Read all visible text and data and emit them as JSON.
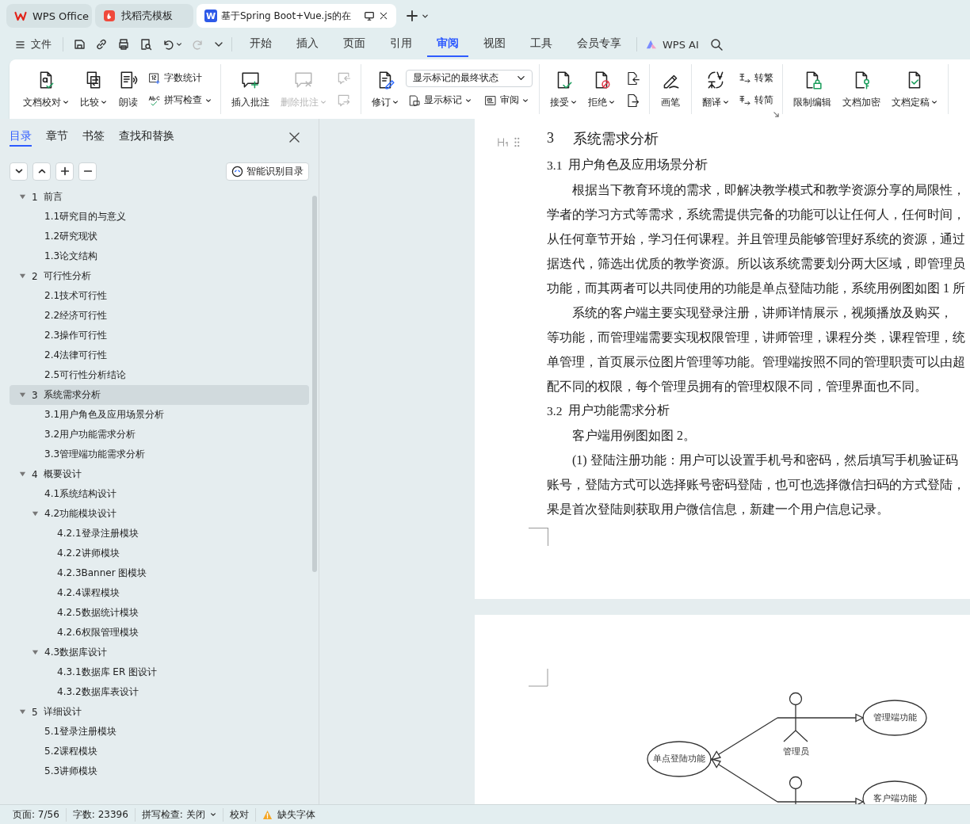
{
  "browser_tabs": [
    {
      "label": "WPS Office",
      "selected": false
    },
    {
      "label": "找稻壳模板",
      "selected": false
    },
    {
      "label": "基于Spring Boot+Vue.js的在",
      "selected": true,
      "badge": "W"
    }
  ],
  "file_menu": {
    "label": "文件"
  },
  "quick_access": [
    {
      "disabled": false,
      "dropdown": false
    },
    {
      "disabled": false,
      "dropdown": false
    },
    {
      "disabled": false,
      "dropdown": false
    },
    {
      "disabled": false,
      "dropdown": false
    },
    {
      "disabled": false,
      "dropdown": true
    },
    {
      "disabled": true,
      "dropdown": false
    }
  ],
  "menu_tabs": [
    {
      "label": "开始",
      "selected": false
    },
    {
      "label": "插入",
      "selected": false
    },
    {
      "label": "页面",
      "selected": false
    },
    {
      "label": "引用",
      "selected": false
    },
    {
      "label": "审阅",
      "selected": true
    },
    {
      "label": "视图",
      "selected": false
    },
    {
      "label": "工具",
      "selected": false
    },
    {
      "label": "会员专享",
      "selected": false
    }
  ],
  "ai_button": {
    "label": "WPS AI"
  },
  "ribbon": {
    "groups": [
      {
        "launcher": false,
        "columns": [
          {
            "kind": "big",
            "label": "文档校对",
            "dropdown": true,
            "disabled": false
          },
          {
            "kind": "big",
            "label": "比较",
            "dropdown": true,
            "disabled": false
          },
          {
            "kind": "big",
            "label": "朗读",
            "dropdown": false,
            "disabled": false
          },
          {
            "kind": "stack",
            "items": [
              {
                "kind": "small",
                "label": "字数统计",
                "dropdown": false,
                "disabled": false
              },
              {
                "kind": "small",
                "label": "拼写检查",
                "dropdown": true,
                "disabled": false
              }
            ]
          }
        ]
      },
      {
        "launcher": false,
        "columns": [
          {
            "kind": "big",
            "label": "插入批注",
            "dropdown": false,
            "disabled": false
          },
          {
            "kind": "big",
            "label": "删除批注",
            "dropdown": true,
            "disabled": true
          },
          {
            "kind": "stack",
            "items": [
              {
                "kind": "icon",
                "disabled": true
              },
              {
                "kind": "icon",
                "disabled": true
              }
            ]
          }
        ]
      },
      {
        "launcher": false,
        "columns": [
          {
            "kind": "big",
            "label": "修订",
            "dropdown": true,
            "disabled": false
          },
          {
            "kind": "stack",
            "items": [
              {
                "kind": "select",
                "value": "显示标记的最终状态"
              },
              {
                "kind": "pair",
                "items": [
                  {
                    "kind": "small",
                    "label": "显示标记",
                    "dropdown": true,
                    "disabled": false
                  },
                  {
                    "kind": "small",
                    "label": "审阅",
                    "dropdown": true,
                    "disabled": false
                  }
                ]
              }
            ]
          }
        ]
      },
      {
        "launcher": false,
        "columns": [
          {
            "kind": "big",
            "label": "接受",
            "dropdown": true,
            "disabled": false
          },
          {
            "kind": "big",
            "label": "拒绝",
            "dropdown": true,
            "disabled": false
          },
          {
            "kind": "stack",
            "items": [
              {
                "kind": "icon",
                "disabled": false
              },
              {
                "kind": "icon",
                "disabled": false
              }
            ]
          }
        ]
      },
      {
        "launcher": false,
        "columns": [
          {
            "kind": "big",
            "label": "画笔",
            "dropdown": false,
            "disabled": false
          }
        ]
      },
      {
        "launcher": true,
        "columns": [
          {
            "kind": "big",
            "label": "翻译",
            "dropdown": true,
            "disabled": false
          },
          {
            "kind": "stack",
            "items": [
              {
                "kind": "small",
                "label": "转繁",
                "dropdown": false,
                "disabled": false
              },
              {
                "kind": "small",
                "label": "转简",
                "dropdown": false,
                "disabled": false
              }
            ]
          }
        ]
      },
      {
        "launcher": false,
        "columns": [
          {
            "kind": "big",
            "label": "限制编辑",
            "dropdown": false,
            "disabled": false
          },
          {
            "kind": "big",
            "label": "文档加密",
            "dropdown": false,
            "disabled": false
          },
          {
            "kind": "big",
            "label": "文档定稿",
            "dropdown": true,
            "disabled": false
          }
        ]
      }
    ]
  },
  "navigation": {
    "tabs": [
      {
        "label": "目录",
        "selected": true
      },
      {
        "label": "章节",
        "selected": false
      },
      {
        "label": "书签",
        "selected": false
      },
      {
        "label": "查找和替换",
        "selected": false
      }
    ],
    "smart_button": {
      "label": "智能识别目录"
    },
    "outline": [
      {
        "number": "1",
        "title": "前言",
        "selected": false,
        "expanded": true,
        "children": [
          {
            "title": "1.1研究目的与意义",
            "selected": false
          },
          {
            "title": "1.2研究现状",
            "selected": false
          },
          {
            "title": "1.3论文结构",
            "selected": false
          }
        ]
      },
      {
        "number": "2",
        "title": "可行性分析",
        "selected": false,
        "expanded": true,
        "children": [
          {
            "title": "2.1技术可行性",
            "selected": false
          },
          {
            "title": "2.2经济可行性",
            "selected": false
          },
          {
            "title": "2.3操作可行性",
            "selected": false
          },
          {
            "title": "2.4法律可行性",
            "selected": false
          },
          {
            "title": "2.5可行性分析结论",
            "selected": false
          }
        ]
      },
      {
        "number": "3",
        "title": "系统需求分析",
        "selected": true,
        "expanded": true,
        "children": [
          {
            "title": "3.1用户角色及应用场景分析",
            "selected": false
          },
          {
            "title": "3.2用户功能需求分析",
            "selected": false
          },
          {
            "title": "3.3管理端功能需求分析",
            "selected": false
          }
        ]
      },
      {
        "number": "4",
        "title": "概要设计",
        "selected": false,
        "expanded": true,
        "children": [
          {
            "title": "4.1系统结构设计",
            "selected": false
          },
          {
            "title": "4.2功能模块设计",
            "selected": false,
            "expanded": true,
            "children": [
              {
                "title": "4.2.1登录注册模块",
                "selected": false
              },
              {
                "title": "4.2.2讲师模块",
                "selected": false
              },
              {
                "title": "4.2.3Banner 图模块",
                "selected": false
              },
              {
                "title": "4.2.4课程模块",
                "selected": false
              },
              {
                "title": "4.2.5数据统计模块",
                "selected": false
              },
              {
                "title": "4.2.6权限管理模块",
                "selected": false
              }
            ]
          },
          {
            "title": "4.3数据库设计",
            "selected": false,
            "expanded": true,
            "children": [
              {
                "title": "4.3.1数据库 ER 图设计",
                "selected": false
              },
              {
                "title": "4.3.2数据库表设计",
                "selected": false
              }
            ]
          }
        ]
      },
      {
        "number": "5",
        "title": "详细设计",
        "selected": false,
        "expanded": true,
        "children": [
          {
            "title": "5.1登录注册模块",
            "selected": false
          },
          {
            "title": "5.2课程模块",
            "selected": false
          },
          {
            "title": "5.3讲师模块",
            "selected": false
          }
        ]
      }
    ]
  },
  "document": {
    "heading": {
      "number": "3",
      "title": "系统需求分析"
    },
    "blocks": [
      {
        "kind": "subheading",
        "number": "3.1",
        "title": "用户角色及应用场景分析"
      },
      {
        "kind": "paragraph",
        "lines": [
          "根据当下教育环境的需求，即解决教学模式和教学资源分享的局限性，",
          "学者的学习方式等需求，系统需提供完备的功能可以让任何人，任何时间，",
          "从任何章节开始，学习任何课程。并且管理员能够管理好系统的资源，通过",
          "据迭代，筛选出优质的教学资源。所以该系统需要划分两大区域，即管理员",
          "功能，而其两者可以共同使用的功能是单点登陆功能，系统用例图如图 1 所"
        ]
      },
      {
        "kind": "paragraph",
        "lines": [
          "系统的客户端主要实现登录注册，讲师详情展示，视频播放及购买，",
          "等功能，而管理端需要实现权限管理，讲师管理，课程分类，课程管理，统",
          "单管理，首页展示位图片管理等功能。管理端按照不同的管理职责可以由超",
          "配不同的权限，每个管理员拥有的管理权限不同，管理界面也不同。"
        ]
      },
      {
        "kind": "subheading",
        "number": "3.2",
        "title": "用户功能需求分析"
      },
      {
        "kind": "paragraph",
        "lines": [
          "客户端用例图如图 2。"
        ]
      },
      {
        "kind": "paragraph",
        "lines": [
          "(1) 登陆注册功能：用户可以设置手机号和密码，然后填写手机验证码",
          "账号，登陆方式可以选择账号密码登陆，也可也选择微信扫码的方式登陆，",
          "果是首次登陆则获取用户微信信息，新建一个用户信息记录。"
        ]
      }
    ],
    "diagram": {
      "use_cases": [
        {
          "label": "单点登陆功能"
        },
        {
          "label": "管理端功能"
        },
        {
          "label": "客户端功能"
        }
      ],
      "actors": [
        {
          "label": "管理员"
        }
      ]
    }
  },
  "status_bar": {
    "items": [
      {
        "kind": "text",
        "label": "页面: 7/56"
      },
      {
        "kind": "text",
        "label": "字数: 23396"
      },
      {
        "kind": "dropdown",
        "label": "拼写检查: 关闭"
      },
      {
        "kind": "text",
        "label": "校对"
      },
      {
        "kind": "warning",
        "label": "缺失字体"
      }
    ]
  }
}
